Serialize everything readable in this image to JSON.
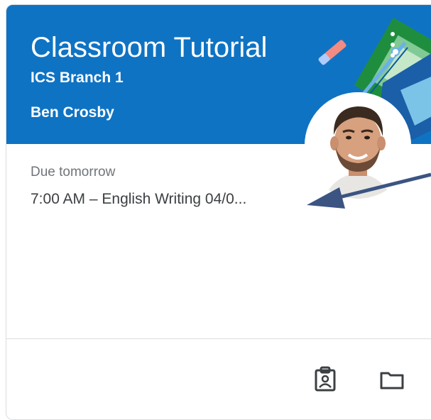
{
  "card": {
    "title": "Classroom Tutorial",
    "section": "ICS Branch 1",
    "teacher": "Ben Crosby",
    "header_color": "#0f73c3",
    "avatar_alt": "teacher-avatar"
  },
  "due": {
    "label": "Due tomorrow",
    "assignment": "7:00 AM – English Writing 04/0..."
  },
  "footer": {
    "icons": [
      "assignment-portfolio-icon",
      "folder-icon"
    ]
  },
  "menu": {
    "icon": "more-vert-icon"
  },
  "colors": {
    "arrow": "#3b5482",
    "header": "#0f73c3"
  }
}
